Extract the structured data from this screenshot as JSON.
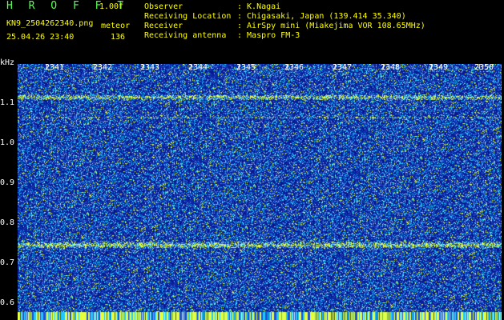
{
  "app": {
    "title": "H R O F F T",
    "version": "1.00f"
  },
  "capture": {
    "filename": "KN9_2504262340.png",
    "datetime": "25.04.26 23:40",
    "meteor_label": "meteor",
    "meteor_count": "136"
  },
  "info": {
    "observer_label": "Observer",
    "observer_value": ": K.Nagai",
    "location_label": "Receiving Location",
    "location_value": ": Chigasaki, Japan (139.414 35.340)",
    "receiver_label": "Receiver",
    "receiver_value": ": AirSpy mini (Miakejima VOR 108.65MHz)",
    "antenna_label": "Receiving antenna",
    "antenna_value": ": Maspro FM-3"
  },
  "axis": {
    "unit": "kHz",
    "y_ticks": [
      "1.1",
      "1.0",
      "0.9",
      "0.8",
      "0.7",
      "0.6"
    ],
    "y_values": [
      1.1,
      1.0,
      0.9,
      0.8,
      0.7,
      0.6
    ],
    "y_range": [
      0.58,
      1.18
    ],
    "x_ticks": [
      "2341",
      "2342",
      "2343",
      "2344",
      "2345",
      "2346",
      "2347",
      "2348",
      "2349",
      "2350"
    ]
  },
  "colors": {
    "background": "#000000",
    "spectrum_base": "#0a1a8c",
    "noise_cyan": "#1ec8ff",
    "signal_yellow": "#e6ff3c",
    "header_green": "#55ff55",
    "header_yellow": "#ffff00"
  }
}
